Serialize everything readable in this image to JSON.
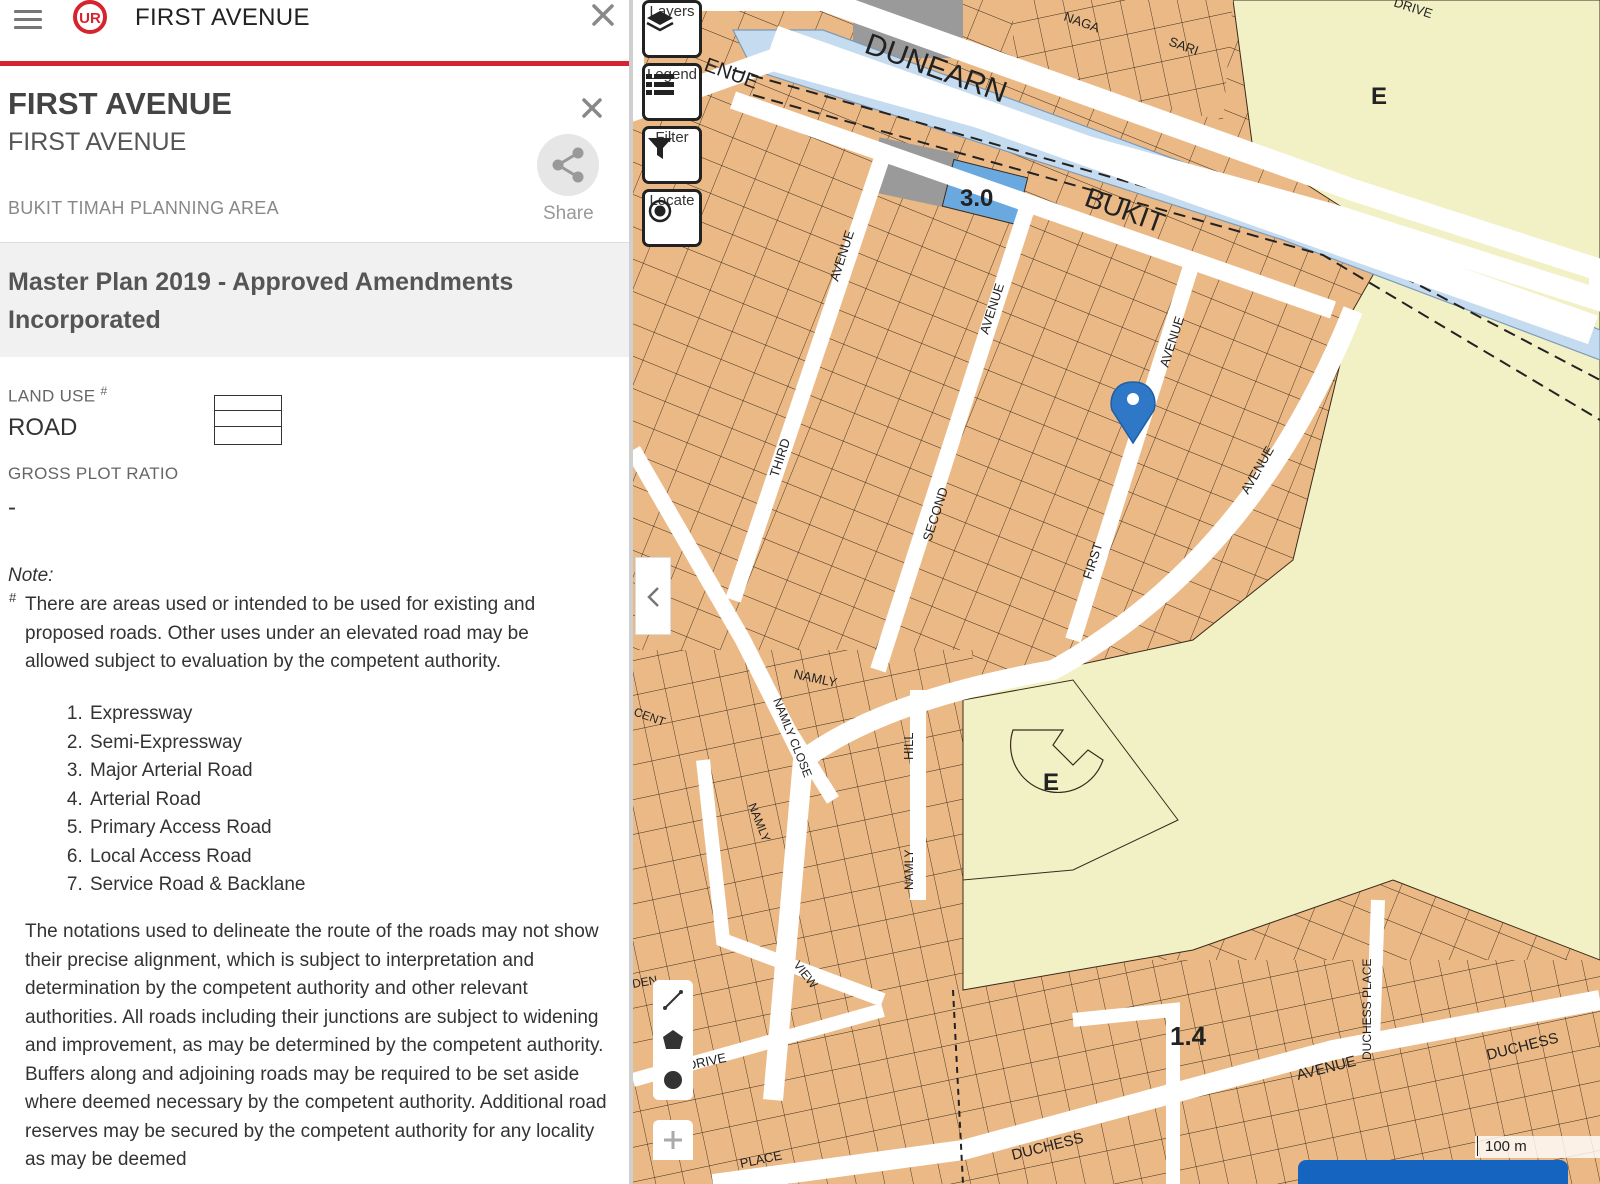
{
  "topbar": {
    "title": "FIRST AVENUE",
    "menu_icon": "hamburger-menu-icon",
    "logo_icon": "ura-logo-icon",
    "close_icon": "close-icon"
  },
  "header": {
    "title": "FIRST AVENUE",
    "subtitle": "FIRST AVENUE",
    "planning_area": "BUKIT TIMAH PLANNING AREA",
    "share_label": "Share"
  },
  "plan": {
    "title": "Master Plan 2019 - Approved Amendments Incorporated"
  },
  "details": {
    "land_use_label": "LAND USE",
    "land_use_sup": "#",
    "land_use_value": "ROAD",
    "gpr_label": "GROSS PLOT RATIO",
    "gpr_value": "-"
  },
  "note": {
    "title": "Note:",
    "hash": "#",
    "text": "There are areas used or intended to be used for existing and proposed roads. Other uses under an elevated road may be allowed subject to evaluation by the competent authority.",
    "roads": [
      "Expressway",
      "Semi-Expressway",
      "Major Arterial Road",
      "Arterial Road",
      "Primary Access Road",
      "Local Access Road",
      "Service Road & Backlane"
    ],
    "paragraph": "The notations used to delineate the route of the roads may not show their precise alignment, which is subject to interpretation and determination by the competent authority and other relevant authorities. All roads including their junctions are subject to widening and improvement, as may be determined by the competent authority. Buffers along and adjoining roads may be required to be set aside where deemed necessary by the competent authority. Additional road reserves may be secured by the competent authority for any locality as may be deemed"
  },
  "map": {
    "tools": [
      {
        "label": "Layers",
        "icon": "layers-icon"
      },
      {
        "label": "Legend",
        "icon": "legend-icon"
      },
      {
        "label": "Filter",
        "icon": "filter-icon"
      },
      {
        "label": "Locate",
        "icon": "locate-icon"
      }
    ],
    "labels": {
      "dunearn": "DUNEARN",
      "bukit": "BUKIT",
      "naga": "NAGA",
      "sari": "SARI",
      "drive": "DRIVE",
      "enue": "ENUE",
      "avenue1": "AVENUE",
      "avenue2": "AVENUE",
      "avenue3": "AVENUE",
      "avenue4": "AVENUE",
      "avenue5": "AVENUE",
      "third": "THIRD",
      "second": "SECOND",
      "first": "FIRST",
      "namly1": "NAMLY",
      "namly2": "NAMLY",
      "namly3": "NAMLY",
      "namly_close": "NAMLY CLOSE",
      "hill": "HILL",
      "view": "VIEW",
      "drive2": "DRIVE",
      "place": "PLACE",
      "duchess1": "DUCHESS",
      "duchess2": "DUCHESS",
      "duchess_place": "DUCHESS PLACE",
      "cent": "CENT",
      "den": "DEN",
      "gpr_30": "3.0",
      "gpr_14": "1.4",
      "zone_e1": "E",
      "zone_e2": "E"
    },
    "scale_label": "100 m",
    "colors": {
      "residential": "#ebb985",
      "educational": "#f2f1c6",
      "road": "#ffffff",
      "canal": "#c5dbef",
      "gpr_highlight": "#6aa9df",
      "marker": "#2e78c7",
      "parcel_line": "#3a2a1a",
      "grey_parcel": "#9a9a9a"
    }
  }
}
